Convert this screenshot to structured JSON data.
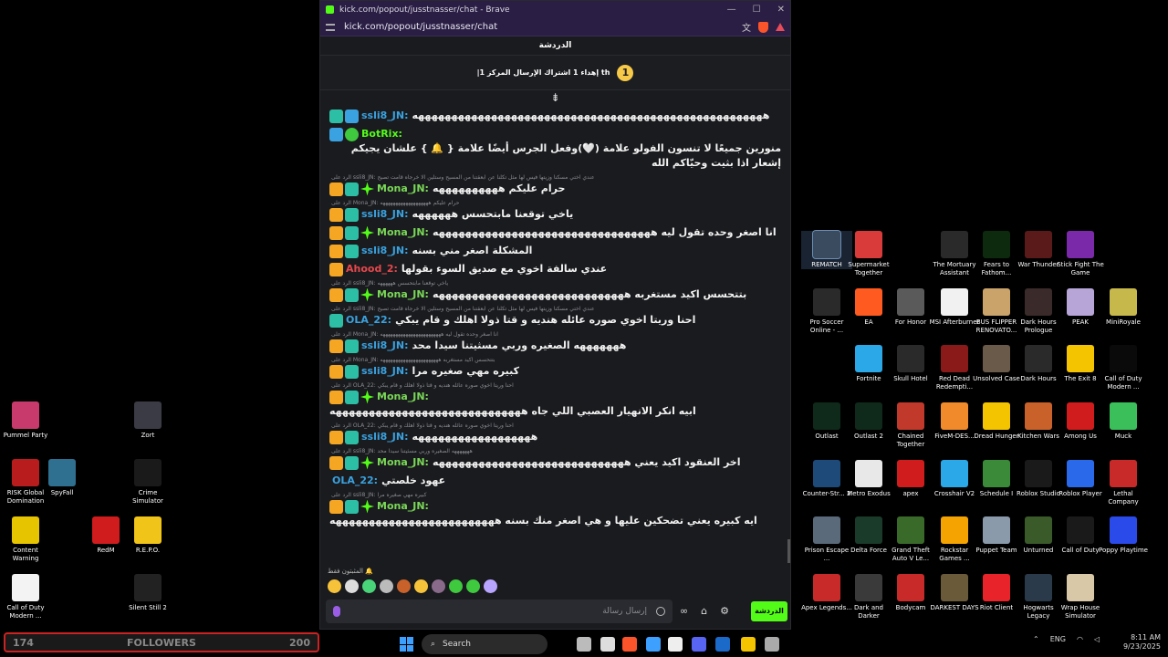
{
  "browser": {
    "title": "kick.com/popout/jusstnasser/chat - Brave",
    "url": "kick.com/popout/jusstnasser/chat",
    "controls": [
      "—",
      "☐",
      "✕"
    ]
  },
  "chat": {
    "header": "الدردشة",
    "pinned_rank": "1",
    "pinned_text": "|إهداء 1 اشتراك الإرسال المركز 1 th",
    "collapse_glyph": "⇟",
    "messages": [
      {
        "type": "msg",
        "user": "ssli8_JN:",
        "user_color": "#3aa2e0",
        "icons": [
          "teal",
          "blue"
        ],
        "text": "هههههههههههههههههههههههههههههههههههههههههههههههههههههه"
      },
      {
        "type": "msg",
        "user": "BotRix:",
        "user_color": "#53fc18",
        "icons": [
          "blue",
          "green"
        ],
        "text": "منورين جميعًا لا تنسون الفولو علامة (🤍)وفعل الجرس أيضًا علامة { 🔔 } علشان يجيكم إشعار اذا بثيت وحيّاكم الله"
      },
      {
        "type": "reply",
        "text": "الرد على ssli8_JN: عندي اختي مسكنا وزيتها فيس لها مثل تكلنا عن ابعقتنا من المسيح وستلين الا خرجاه قامت تصيح"
      },
      {
        "type": "msg",
        "user": "Mona_JN:",
        "user_color": "#7ad957",
        "icons": [
          "crown",
          "teal",
          "star"
        ],
        "text": "حرام عليكم ههههههههههه"
      },
      {
        "type": "reply",
        "text": "الرد على Mona_JN: حرام عليكم هههههههههههههههههههه"
      },
      {
        "type": "msg",
        "user": "ssli8_JN:",
        "user_color": "#3aa2e0",
        "icons": [
          "crown",
          "teal"
        ],
        "text": "ياخي توقعنا مابتحسس ههههههه"
      },
      {
        "type": "msg",
        "user": "Mona_JN:",
        "user_color": "#7ad957",
        "icons": [
          "crown",
          "teal",
          "star"
        ],
        "text": "انا اصغر وحده تقول ليه هههههههههههههههههههههههههههههههههه"
      },
      {
        "type": "msg",
        "user": "ssli8_JN:",
        "user_color": "#3aa2e0",
        "icons": [
          "crown",
          "teal"
        ],
        "text": "المشكلة اصغر مني بسنه"
      },
      {
        "type": "msg",
        "user": "Ahood_2:",
        "user_color": "#e5484d",
        "icons": [
          "crown"
        ],
        "text": "عندي سالفة اخوي مع صديق السوء بقولها"
      },
      {
        "type": "reply",
        "text": "الرد على ssli8_JN: ياخي توقعنا مابتحسس ههههههه"
      },
      {
        "type": "msg",
        "user": "Mona_JN:",
        "user_color": "#7ad957",
        "icons": [
          "crown",
          "teal",
          "star"
        ],
        "text": "بتتحسس اكيد مستغربه هههههههههههههههههههههههههههههه"
      },
      {
        "type": "reply",
        "text": "الرد على ssli8_JN: عندي اختي مسكنا وزيتها فيس لها مثل تكلنا عن ابعقتنا من المسيح وستلين الا خرجاه قامت تصيح"
      },
      {
        "type": "msg",
        "user": "OLA_22:",
        "user_color": "#3aa2e0",
        "icons": [
          "teal"
        ],
        "text": "احنا وريتا اخوي صوره عائله هنديه و قتا ذولا اهلك و قام يبكي"
      },
      {
        "type": "reply",
        "text": "الرد على Mona_JN: انا اصغر وحده تقول ليه ههههههههههههههههههههههههه"
      },
      {
        "type": "msg",
        "user": "ssli8_JN:",
        "user_color": "#3aa2e0",
        "icons": [
          "crown",
          "teal"
        ],
        "text": "هههههههه الصغيره وربي مسثيتنا سيدا محد"
      },
      {
        "type": "reply",
        "text": "الرد على Mona_JN: بتتحسس اكيد مستغربه هههههههههههههههههههههههه"
      },
      {
        "type": "msg",
        "user": "ssli8_JN:",
        "user_color": "#3aa2e0",
        "icons": [
          "crown",
          "teal"
        ],
        "text": "كبيره مهي صغيره مرا"
      },
      {
        "type": "reply",
        "text": "الرد على OLA_22: احنا وريتا اخوي صوره عائله هنديه و قتا ذولا اهلك و قام يبكي"
      },
      {
        "type": "msg",
        "user": "Mona_JN:",
        "user_color": "#7ad957",
        "icons": [
          "crown",
          "teal",
          "star"
        ],
        "text": "ابيه انكر الانهيار العصبي اللي جاه هههههههههههههههههههههههههههههه"
      },
      {
        "type": "reply",
        "text": "الرد على OLA_22: احنا وريتا اخوي صوره عائله هنديه و قتا ذولا اهلك و قام يبكي"
      },
      {
        "type": "msg",
        "user": "ssli8_JN:",
        "user_color": "#3aa2e0",
        "icons": [
          "crown",
          "teal"
        ],
        "text": "ههههههههههههههههههه"
      },
      {
        "type": "reply",
        "text": "الرد على ssli8_JN: هههههههه الصغيره وربي مسثيتنا سيدا محد"
      },
      {
        "type": "msg",
        "user": "Mona_JN:",
        "user_color": "#7ad957",
        "icons": [
          "crown",
          "teal",
          "star"
        ],
        "text": "اخر العنقود اكيد يعني هههههههههههههههههههههههههههههه"
      },
      {
        "type": "msg",
        "user": "OLA_22:",
        "user_color": "#3aa2e0",
        "icons": [],
        "text": "عهود خلصتي"
      },
      {
        "type": "reply",
        "text": "الرد على ssli8_JN: كبيره مهي صغيره مرا"
      },
      {
        "type": "msg",
        "user": "Mona_JN:",
        "user_color": "#7ad957",
        "icons": [
          "crown",
          "teal",
          "star"
        ],
        "text": "ايه كبيره يعني تضحكين عليها و هي اصغر منك بسنه هههههههههههههههههههههههههه"
      }
    ],
    "pinned_users_label": "المثبتون فقط 🔔",
    "composer_placeholder": "إرسال رسالة",
    "send_label": "الدردشة"
  },
  "desktop_icons": [
    {
      "label": "Pummel Party",
      "color": "#c83a6b"
    },
    {
      "label": "Zort",
      "color": "#3b3b46"
    },
    {
      "label": "RISK Global Domination",
      "color": "#b91c1c"
    },
    {
      "label": "SpyFall",
      "color": "#2f6f8f"
    },
    {
      "label": "Crime Simulator",
      "color": "#1a1a1a"
    },
    {
      "label": "Content Warning",
      "color": "#e6c400"
    },
    {
      "label": "RedM",
      "color": "#d01c1c"
    },
    {
      "label": "R.E.P.O.",
      "color": "#f0c419"
    },
    {
      "label": "Call of Duty Modern ...",
      "color": "#f3f3f3"
    },
    {
      "label": "Silent Still 2",
      "color": "#222"
    },
    {
      "label": "REMATCH",
      "color": "#3a4a5f"
    },
    {
      "label": "Supermarket Together",
      "color": "#d93a3a"
    },
    {
      "label": "The Mortuary Assistant",
      "color": "#2a2a2a"
    },
    {
      "label": "Fears to Fathom...",
      "color": "#0e2a0e"
    },
    {
      "label": "War Thunder",
      "color": "#5a1a1a"
    },
    {
      "label": "Stick Fight The Game",
      "color": "#7a2aa8"
    },
    {
      "label": "Pro Soccer Online - ...",
      "color": "#2a2a2a"
    },
    {
      "label": "EA",
      "color": "#ff5a1f"
    },
    {
      "label": "For Honor",
      "color": "#5a5a5a"
    },
    {
      "label": "MSI Afterburner",
      "color": "#f1f1f1"
    },
    {
      "label": "BUS FLIPPER RENOVATO...",
      "color": "#c9a36a"
    },
    {
      "label": "Dark Hours Prologue",
      "color": "#3a2a2a"
    },
    {
      "label": "PEAK",
      "color": "#b8a5d8"
    },
    {
      "label": "MiniRoyale",
      "color": "#c7b84c"
    },
    {
      "label": "Fortnite",
      "color": "#2aa8e8"
    },
    {
      "label": "Skull Hotel",
      "color": "#2a2a2a"
    },
    {
      "label": "Red Dead Redempti...",
      "color": "#8a1a1a"
    },
    {
      "label": "Unsolved Case",
      "color": "#6a5a4a"
    },
    {
      "label": "Dark Hours",
      "color": "#2a2a2a"
    },
    {
      "label": "The Exit 8",
      "color": "#f4c400"
    },
    {
      "label": "Call of Duty Modern ...",
      "color": "#0a0a0a"
    },
    {
      "label": "Outlast",
      "color": "#0f2a1a"
    },
    {
      "label": "Outlast 2",
      "color": "#0f2a1a"
    },
    {
      "label": "Chained Together",
      "color": "#c0392b"
    },
    {
      "label": "FiveM-DES...",
      "color": "#f08a2a"
    },
    {
      "label": "Dread Hunger",
      "color": "#f4c400"
    },
    {
      "label": "Kitchen Wars",
      "color": "#c8622a"
    },
    {
      "label": "Among Us",
      "color": "#d01c1c"
    },
    {
      "label": "Muck",
      "color": "#3abf5a"
    },
    {
      "label": "Counter-Str... 2",
      "color": "#1e4a7a"
    },
    {
      "label": "Metro Exodus",
      "color": "#e8e8e8"
    },
    {
      "label": "apex",
      "color": "#d01c1c"
    },
    {
      "label": "Crosshair V2",
      "color": "#2aa8e8"
    },
    {
      "label": "Schedule I",
      "color": "#3a8a3a"
    },
    {
      "label": "Roblox Studio",
      "color": "#1a1a1a"
    },
    {
      "label": "Roblox Player",
      "color": "#2a6aea"
    },
    {
      "label": "Lethal Company",
      "color": "#c82a2a"
    },
    {
      "label": "Prison Escape ...",
      "color": "#5a6a7a"
    },
    {
      "label": "Delta Force",
      "color": "#1a3a2a"
    },
    {
      "label": "Grand Theft Auto V Le...",
      "color": "#3a6a2a"
    },
    {
      "label": "Rockstar Games ...",
      "color": "#f4a300"
    },
    {
      "label": "Puppet Team",
      "color": "#8a9aaa"
    },
    {
      "label": "Unturned",
      "color": "#3a5a2a"
    },
    {
      "label": "Call of Duty",
      "color": "#1a1a1a"
    },
    {
      "label": "Poppy Playtime",
      "color": "#2a4aea"
    },
    {
      "label": "Apex Legends...",
      "color": "#c82a2a"
    },
    {
      "label": "Dark and Darker",
      "color": "#3a3a3a"
    },
    {
      "label": "Bodycam",
      "color": "#c82a2a"
    },
    {
      "label": "DARKEST DAYS",
      "color": "#6a5a3a"
    },
    {
      "label": "Riot Client",
      "color": "#e8242a"
    },
    {
      "label": "Hogwarts Legacy",
      "color": "#2a3a4a"
    },
    {
      "label": "Wrap House Simulator",
      "color": "#d8c8a8"
    }
  ],
  "followers_bar": {
    "left": "174",
    "label": "FOLLOWERS",
    "right": "200"
  },
  "taskbar": {
    "search_label": "Search",
    "language": "ENG",
    "time": "8:11 AM",
    "date": "9/23/2025",
    "badge": "2",
    "app_colors": [
      "#bbb",
      "#ddd",
      "#fb542b",
      "#3da0ff",
      "#eee",
      "#5865f2",
      "#1b6ac9",
      "#f4c400",
      "#aaa"
    ]
  }
}
